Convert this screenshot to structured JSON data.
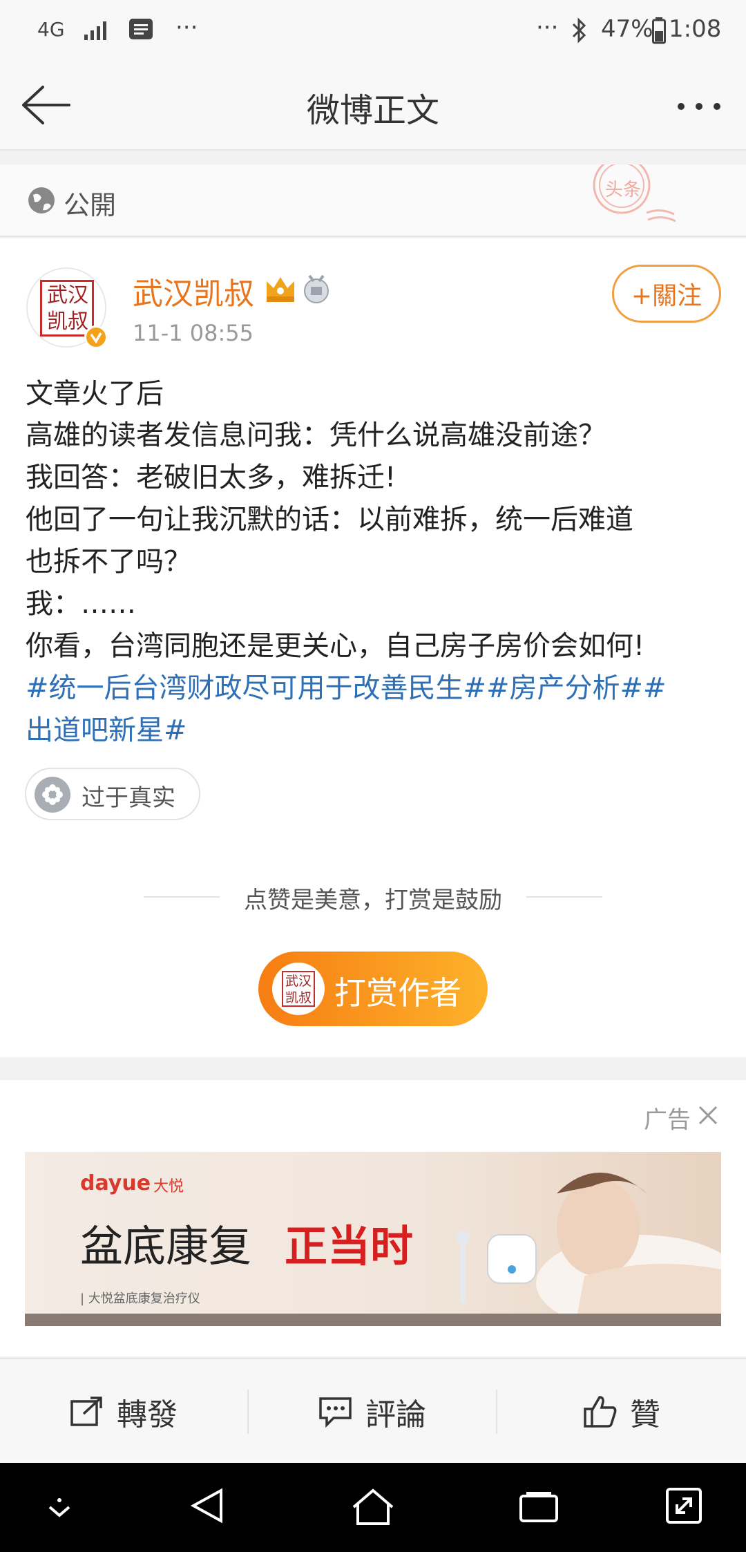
{
  "status_bar": {
    "network": "4G",
    "battery": "47%",
    "time": "1:08",
    "more": "···",
    "left_more": "···"
  },
  "nav": {
    "title": "微博正文",
    "more": "···"
  },
  "privacy": {
    "label": "公開",
    "stamp": "头条"
  },
  "post": {
    "author": "武汉凯叔",
    "avatar_text": "武汉凯叔",
    "time": "11-1 08:55",
    "follow_label": "+關注",
    "lines": [
      "文章火了后",
      "高雄的读者发信息问我：凭什么说高雄没前途？",
      "我回答：老破旧太多，难拆迁!",
      "他回了一句让我沉默的话：以前难拆，统一后难道",
      "也拆不了吗？",
      "我：……",
      "你看，台湾同胞还是更关心，自己房子房价会如何!"
    ],
    "topics_line1": "#统一后台湾财政尽可用于改善民生##房产分析##",
    "topics_line2": "出道吧新星#",
    "tag_label": "过于真实",
    "reward_hint": "点赞是美意，打赏是鼓励",
    "reward_button": "打赏作者"
  },
  "ad": {
    "label": "广告",
    "brand": "dayue",
    "brand_cn": "大悦",
    "headline_a": "盆底康复",
    "headline_b": "正当时",
    "subline": "| 大悦盆底康复治疗仪"
  },
  "actions": {
    "repost": "轉發",
    "comment": "評論",
    "like": "贊"
  },
  "colors": {
    "accent_orange": "#f08a1c",
    "topic_blue": "#2f6fb5",
    "author_orange": "#e8741c"
  }
}
